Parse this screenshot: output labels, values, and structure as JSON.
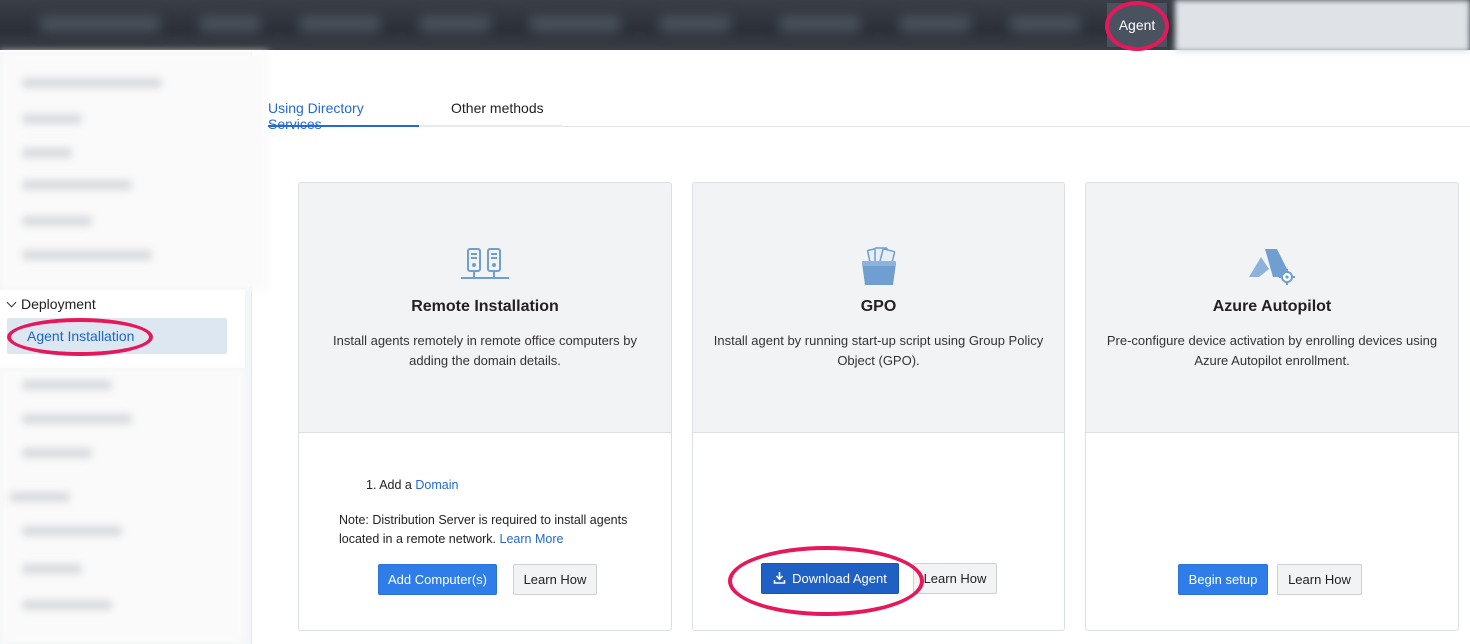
{
  "topbar": {
    "agent_tab_label": "Agent"
  },
  "sidebar": {
    "group_label": "Deployment",
    "active_item_label": "Agent Installation"
  },
  "tabs": [
    {
      "label": "Using Directory Services",
      "active": true
    },
    {
      "label": "Other methods",
      "active": false
    }
  ],
  "cards": {
    "remote": {
      "icon": "servers-icon",
      "title": "Remote Installation",
      "description": "Install agents remotely in remote office computers by adding the domain details.",
      "step_prefix": "1. Add a",
      "step_link": "Domain",
      "note_text": "Note: Distribution Server is required to install agents located in a remote network.",
      "note_link": "Learn More",
      "primary_button": "Add Computer(s)",
      "secondary_button": "Learn How"
    },
    "gpo": {
      "icon": "gpo-folder-icon",
      "title": "GPO",
      "description": "Install agent by running start-up script using Group Policy Object (GPO).",
      "primary_button": "Download Agent",
      "secondary_button": "Learn How"
    },
    "azure": {
      "icon": "azure-autopilot-icon",
      "title": "Azure Autopilot",
      "description": "Pre-configure device activation by enrolling devices using Azure Autopilot enrollment.",
      "primary_button": "Begin setup",
      "secondary_button": "Learn How"
    }
  },
  "colors": {
    "accent": "#2468d6",
    "primary_button": "#2f7de8",
    "highlight_ring": "#e6175a",
    "icon_blue": "#6f9fd0"
  }
}
